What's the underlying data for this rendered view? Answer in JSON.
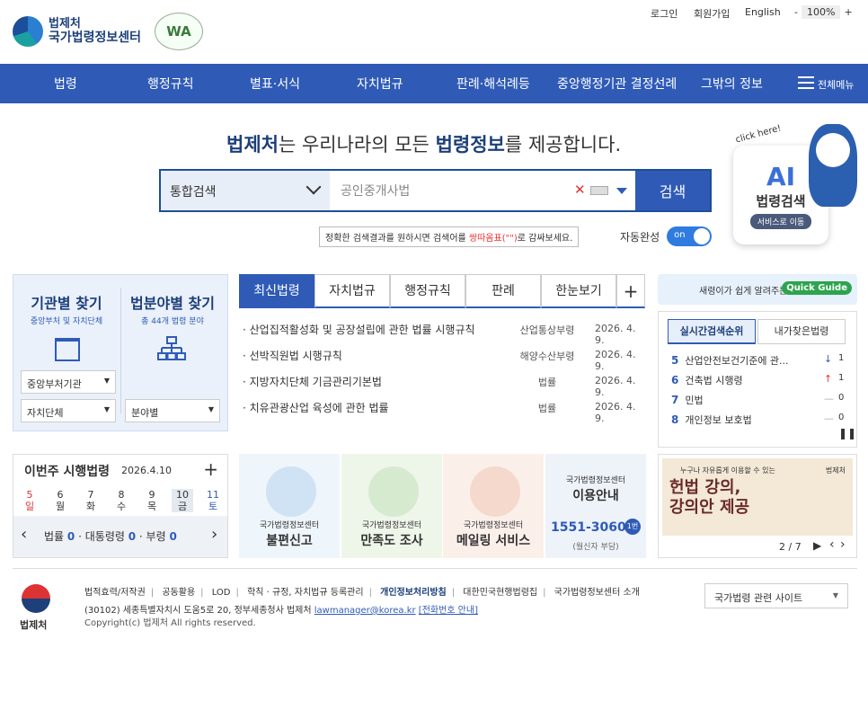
{
  "header": {
    "logo_top": "법제처",
    "logo_bottom": "국가법령정보센터",
    "wa_mark": "WA",
    "util": [
      "로그인",
      "회원가입",
      "English"
    ],
    "zoom_minus": "-",
    "zoom_value": "100%",
    "zoom_plus": "+"
  },
  "nav": {
    "items": [
      "법령",
      "행정규칙",
      "별표·서식",
      "자치법규",
      "판례·해석례등",
      "중앙행정기관 결정선례",
      "그밖의 정보"
    ],
    "all_menu": "전체메뉴"
  },
  "hero": {
    "tagline_a": "법제처",
    "tagline_b": "는 우리나라의 모든 ",
    "tagline_c": "법령정보",
    "tagline_d": "를 제공합니다.",
    "search_scope": "통합검색",
    "search_value": "공인중개사법",
    "search_button": "검색",
    "tip_a": "정확한 검색결과를 원하시면 검색어를 ",
    "tip_b": "쌍따옴표(\"\")",
    "tip_c": "로 감싸보세요.",
    "auto_label": "자동완성",
    "auto_state": "on"
  },
  "ai": {
    "click": "click here!",
    "big": "AI",
    "title": "법령검색",
    "cta": "서비스로 이동"
  },
  "finder": {
    "agency_title": "기관별 찾기",
    "agency_sub": "중앙부처 및 자치단체",
    "field_title": "법분야별 찾기",
    "field_sub": "총 44개 법령 분야",
    "sel1": "중앙부처기관",
    "sel2": "자치단체",
    "sel3": "분야별"
  },
  "tabs": [
    "최신법령",
    "자치법규",
    "행정규칙",
    "판례",
    "한눈보기"
  ],
  "tab_plus": "+",
  "news": [
    {
      "title": "· 산업집적활성화 및 공장설립에 관한 법률 시행규칙",
      "agency": "산업통상부령",
      "date": "2026. 4. 9."
    },
    {
      "title": "· 선박직원법 시행규칙",
      "agency": "해양수산부령",
      "date": "2026. 4. 9."
    },
    {
      "title": "· 지방자치단체 기금관리기본법",
      "agency": "법률",
      "date": "2026. 4. 9."
    },
    {
      "title": "· 치유관광산업 육성에 관한 법률",
      "agency": "법률",
      "date": "2026. 4. 9."
    }
  ],
  "quick": {
    "text": "새령이가 쉽게 알려주는 국법",
    "badge": "Quick Guide"
  },
  "rank": {
    "tab1": "실시간검색순위",
    "tab2": "내가찾은법령",
    "rows": [
      {
        "n": "5",
        "name": "산업안전보건기준에 관...",
        "ch": "↓",
        "v": "1"
      },
      {
        "n": "6",
        "name": "건축법 시행령",
        "ch": "↑",
        "v": "1"
      },
      {
        "n": "7",
        "name": "민법",
        "ch": "—",
        "v": "0"
      },
      {
        "n": "8",
        "name": "개인정보 보호법",
        "ch": "—",
        "v": "0"
      }
    ],
    "pause": "❚❚"
  },
  "week": {
    "title": "이번주 시행법령",
    "date": "2026.4.10",
    "plus": "+",
    "days": [
      {
        "d": "5",
        "w": "일"
      },
      {
        "d": "6",
        "w": "월"
      },
      {
        "d": "7",
        "w": "화"
      },
      {
        "d": "8",
        "w": "수"
      },
      {
        "d": "9",
        "w": "목"
      },
      {
        "d": "10",
        "w": "금"
      },
      {
        "d": "11",
        "w": "토"
      }
    ],
    "law_label": "법률",
    "law_n": "0",
    "decree_label": "· 대통령령",
    "decree_n": "0",
    "ord_label": "· 부령",
    "ord_n": "0"
  },
  "cards": [
    {
      "l1": "국가법령정보센터",
      "l2": "불편신고"
    },
    {
      "l1": "국가법령정보센터",
      "l2": "만족도 조사"
    },
    {
      "l1": "국가법령정보센터",
      "l2": "메일링 서비스"
    },
    {
      "l1": "국가법령정보센터",
      "l2": "이용안내",
      "phone": "1551-3060",
      "badge": "1번",
      "note": "(월신자 부담)"
    }
  ],
  "banner": {
    "small": "누구나 자유롭게 이용할 수 있는",
    "line1": "헌법 강의,",
    "line2": "강의안 제공",
    "ministry": "법제처",
    "page": "2 / 7"
  },
  "footer": {
    "org": "법제처",
    "links": [
      "법적효력/저작권",
      "공동활용",
      "LOD",
      "학칙 · 규정, 자치법규 등록관리",
      "개인정보처리방침",
      "대한민국현행법령집",
      "국가법령정보센터 소개"
    ],
    "addr": "(30102) 세종특별자치시 도움5로 20, 정부세종청사 법제처 ",
    "email": "lawmanager@korea.kr",
    "phone_link": "[전화번호 안내]",
    "copy": "Copyright(c) 법제처 All rights reserved.",
    "related": "국가법령 관련 사이트"
  },
  "colors": {
    "nav": "#2f5bb7",
    "brand": "#1d3f7a"
  }
}
